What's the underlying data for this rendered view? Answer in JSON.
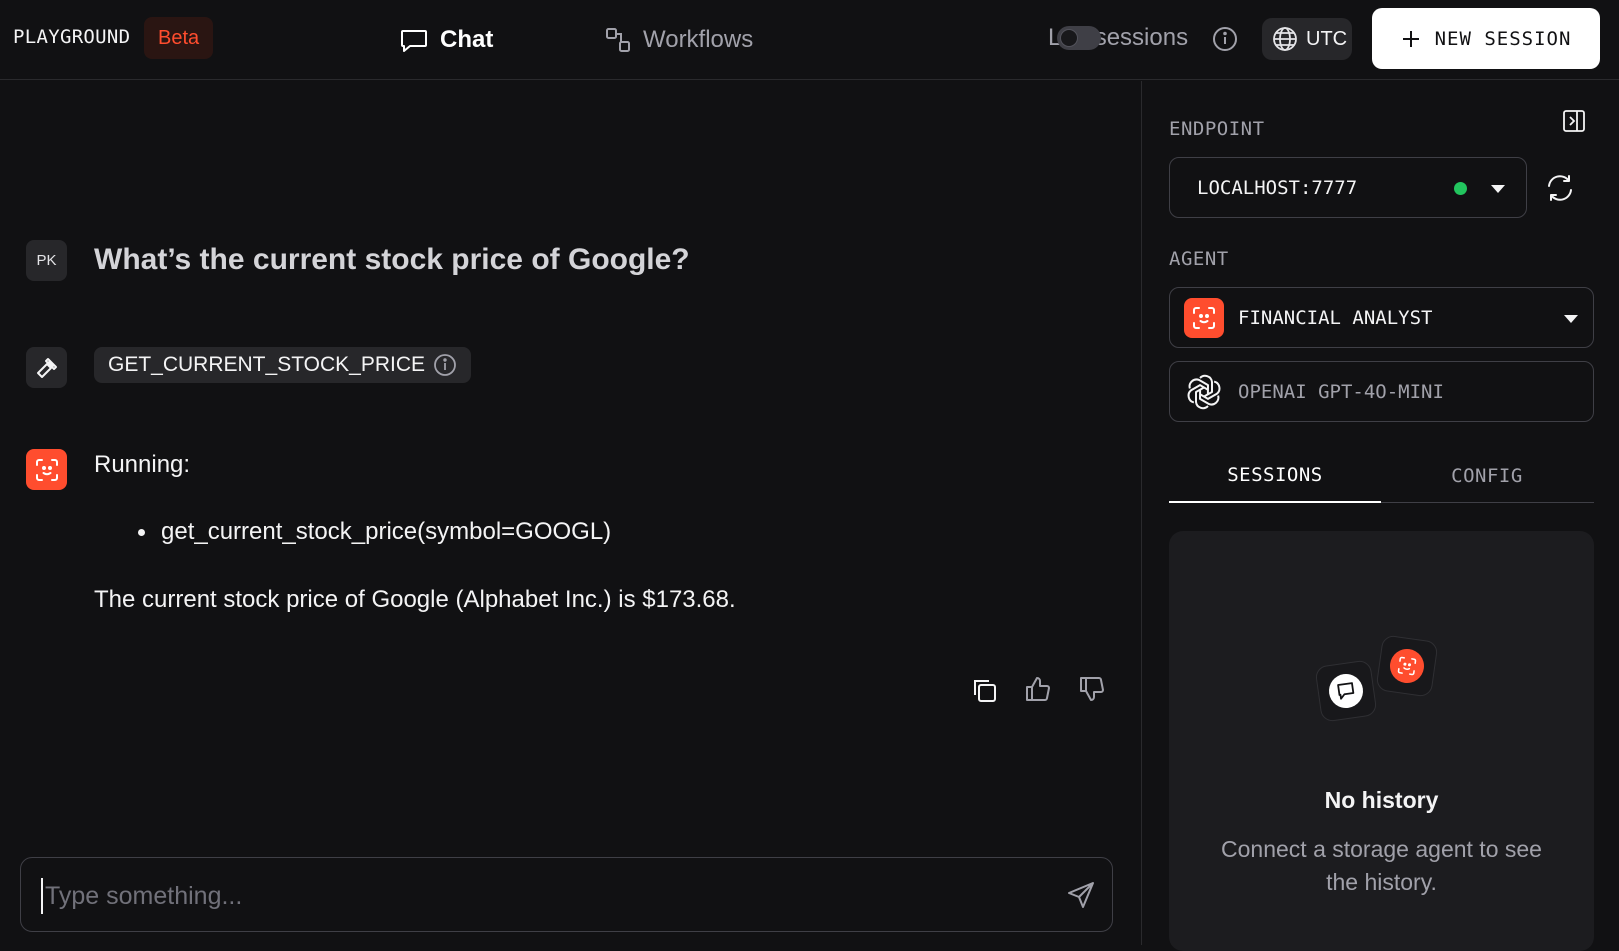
{
  "header": {
    "brand": "PLAYGROUND",
    "beta": "Beta",
    "nav": {
      "chat": "Chat",
      "workflows": "Workflows"
    },
    "log_sessions": "Log sessions",
    "timezone": "UTC",
    "new_session": "NEW SESSION"
  },
  "chat": {
    "user_initials": "PK",
    "question": "What’s the current stock price of Google?",
    "tool_call": "GET_CURRENT_STOCK_PRICE",
    "running_label": "Running:",
    "running_items": [
      "get_current_stock_price(symbol=GOOGL)"
    ],
    "answer": "The current stock price of Google (Alphabet Inc.) is $173.68.",
    "input_placeholder": "Type something..."
  },
  "sidebar": {
    "endpoint_label": "ENDPOINT",
    "endpoint_value": "LOCALHOST:7777",
    "endpoint_status_color": "#22c55e",
    "agent_label": "AGENT",
    "agent_value": "FINANCIAL ANALYST",
    "model_value": "OPENAI GPT-4O-MINI",
    "tabs": [
      "SESSIONS",
      "CONFIG"
    ],
    "active_tab": "SESSIONS",
    "empty_title": "No history",
    "empty_subtitle": "Connect a storage agent to see the history."
  },
  "colors": {
    "accent": "#ff4d2e",
    "background": "#111113",
    "surface": "#27272a"
  },
  "icons": [
    "chat-bubble-icon",
    "workflows-icon",
    "info-icon",
    "globe-icon",
    "plus-icon",
    "hammer-icon",
    "agent-focus-icon",
    "copy-icon",
    "thumbs-up-icon",
    "thumbs-down-icon",
    "send-icon",
    "sidebar-collapse-icon",
    "refresh-icon",
    "openai-icon"
  ]
}
